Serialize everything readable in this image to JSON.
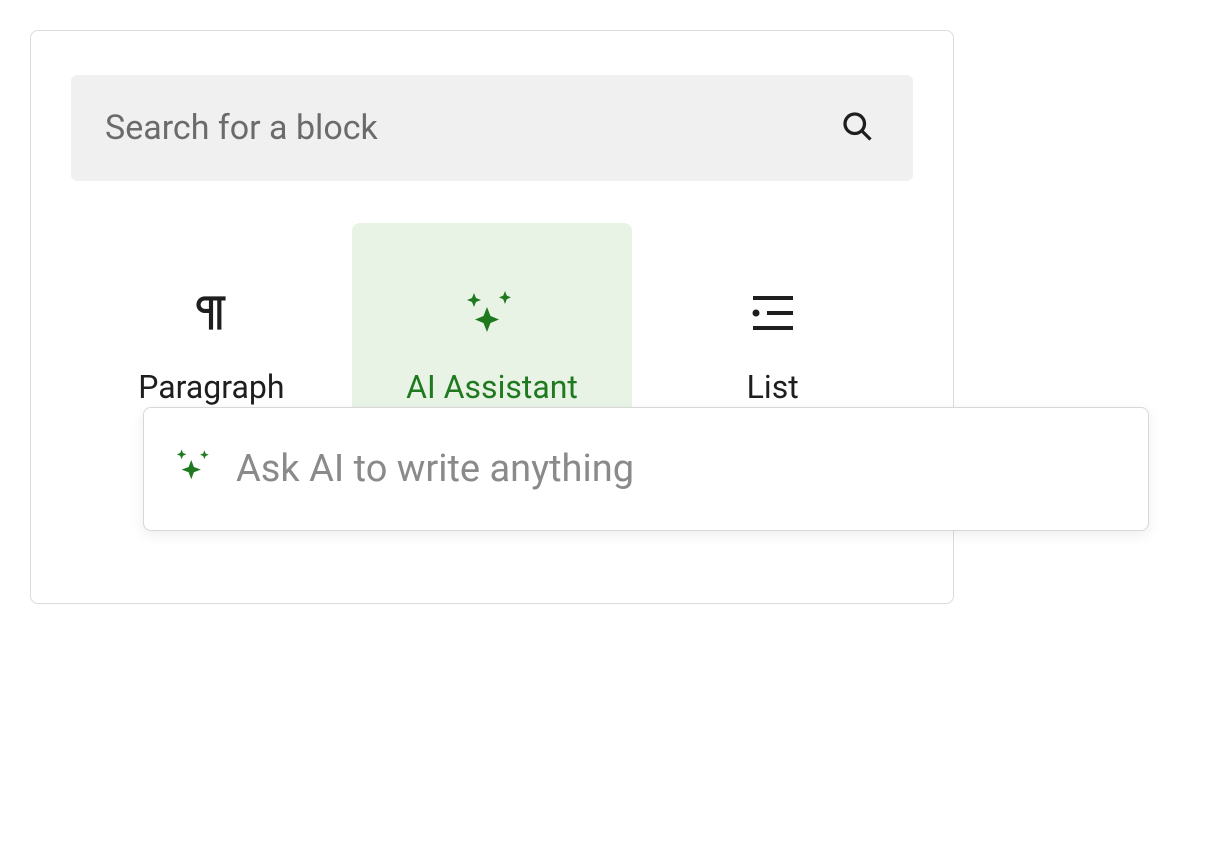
{
  "search": {
    "placeholder": "Search for a block"
  },
  "blocks": {
    "paragraph": {
      "label": "Paragraph"
    },
    "ai_assistant": {
      "label": "AI Assistant"
    },
    "list": {
      "label": "List"
    }
  },
  "ask_ai": {
    "placeholder": "Ask AI to write anything"
  },
  "colors": {
    "accent": "#1f7a1f",
    "selected_bg": "#e8f3e6"
  },
  "icons": {
    "search": "search-icon",
    "paragraph": "paragraph-icon",
    "sparkles": "sparkles-icon",
    "list": "list-icon"
  }
}
